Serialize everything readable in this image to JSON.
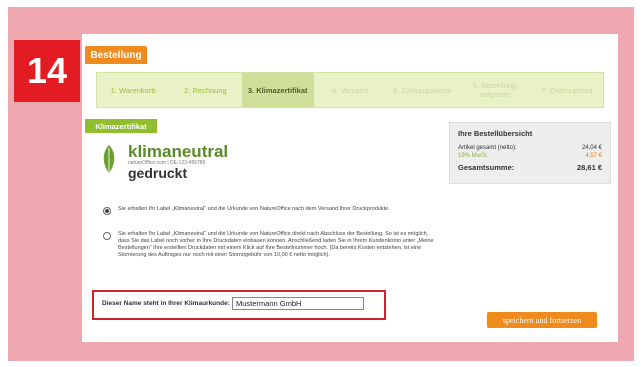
{
  "badge": "14",
  "header": {
    "tab_label": "Bestellung"
  },
  "steps": [
    {
      "label": "1. Warenkorb",
      "state": "done"
    },
    {
      "label": "2. Rechnung",
      "state": "done"
    },
    {
      "label": "3. Klimazertifikat",
      "state": "active"
    },
    {
      "label": "4. Versand",
      "state": "todo"
    },
    {
      "label": "5. Zahlungsweise",
      "state": "todo"
    },
    {
      "label": "6. Bestellung aufgeben",
      "state": "todo"
    },
    {
      "label": "7. Datenupload",
      "state": "todo"
    }
  ],
  "section_tab": "Klimazertifikat",
  "logo": {
    "word1": "klimaneutral",
    "sub": "natureOffice.com | DE-123-456789",
    "word2": "gedruckt"
  },
  "summary": {
    "title": "Ihre Bestellübersicht",
    "articles_label": "Artikel gesamt (netto):",
    "articles_value": "24,04 €",
    "vat_label": "19% MwSt.",
    "vat_value": "4,57 €",
    "total_label": "Gesamtsumme:",
    "total_value": "28,61 €"
  },
  "options": {
    "opt1": "Sie erhalten Ihr Label „Klimaneutral“ und die Urkunde von NatureOffice nach dem Versand Ihrer Druckprodukte.",
    "opt2": "Sie erhalten Ihr Label „Klimaneutral“ und die Urkunde von NatureOffice direkt nach Abschluss der Bestellung. So ist es möglich, dass Sie das Label noch vorher in Ihre Druckdaten einbauen können. Anschließend laden Sie in Ihrem Kundenkonto unter „Meine Bestellungen“ Ihre erstellten Druckdaten mit einem Klick auf Ihre Bestellnummer hoch. (Da bereits Kosten entstehen, ist eine Stornierung des Auftrages nur noch mit einer Stornogebühr von 10,00 € netto möglich)."
  },
  "name_field": {
    "label": "Dieser Name steht in Ihrer Klimaurkunde:",
    "value": "Mustermann GmbH"
  },
  "save_button": "speichern und fortsetzen"
}
